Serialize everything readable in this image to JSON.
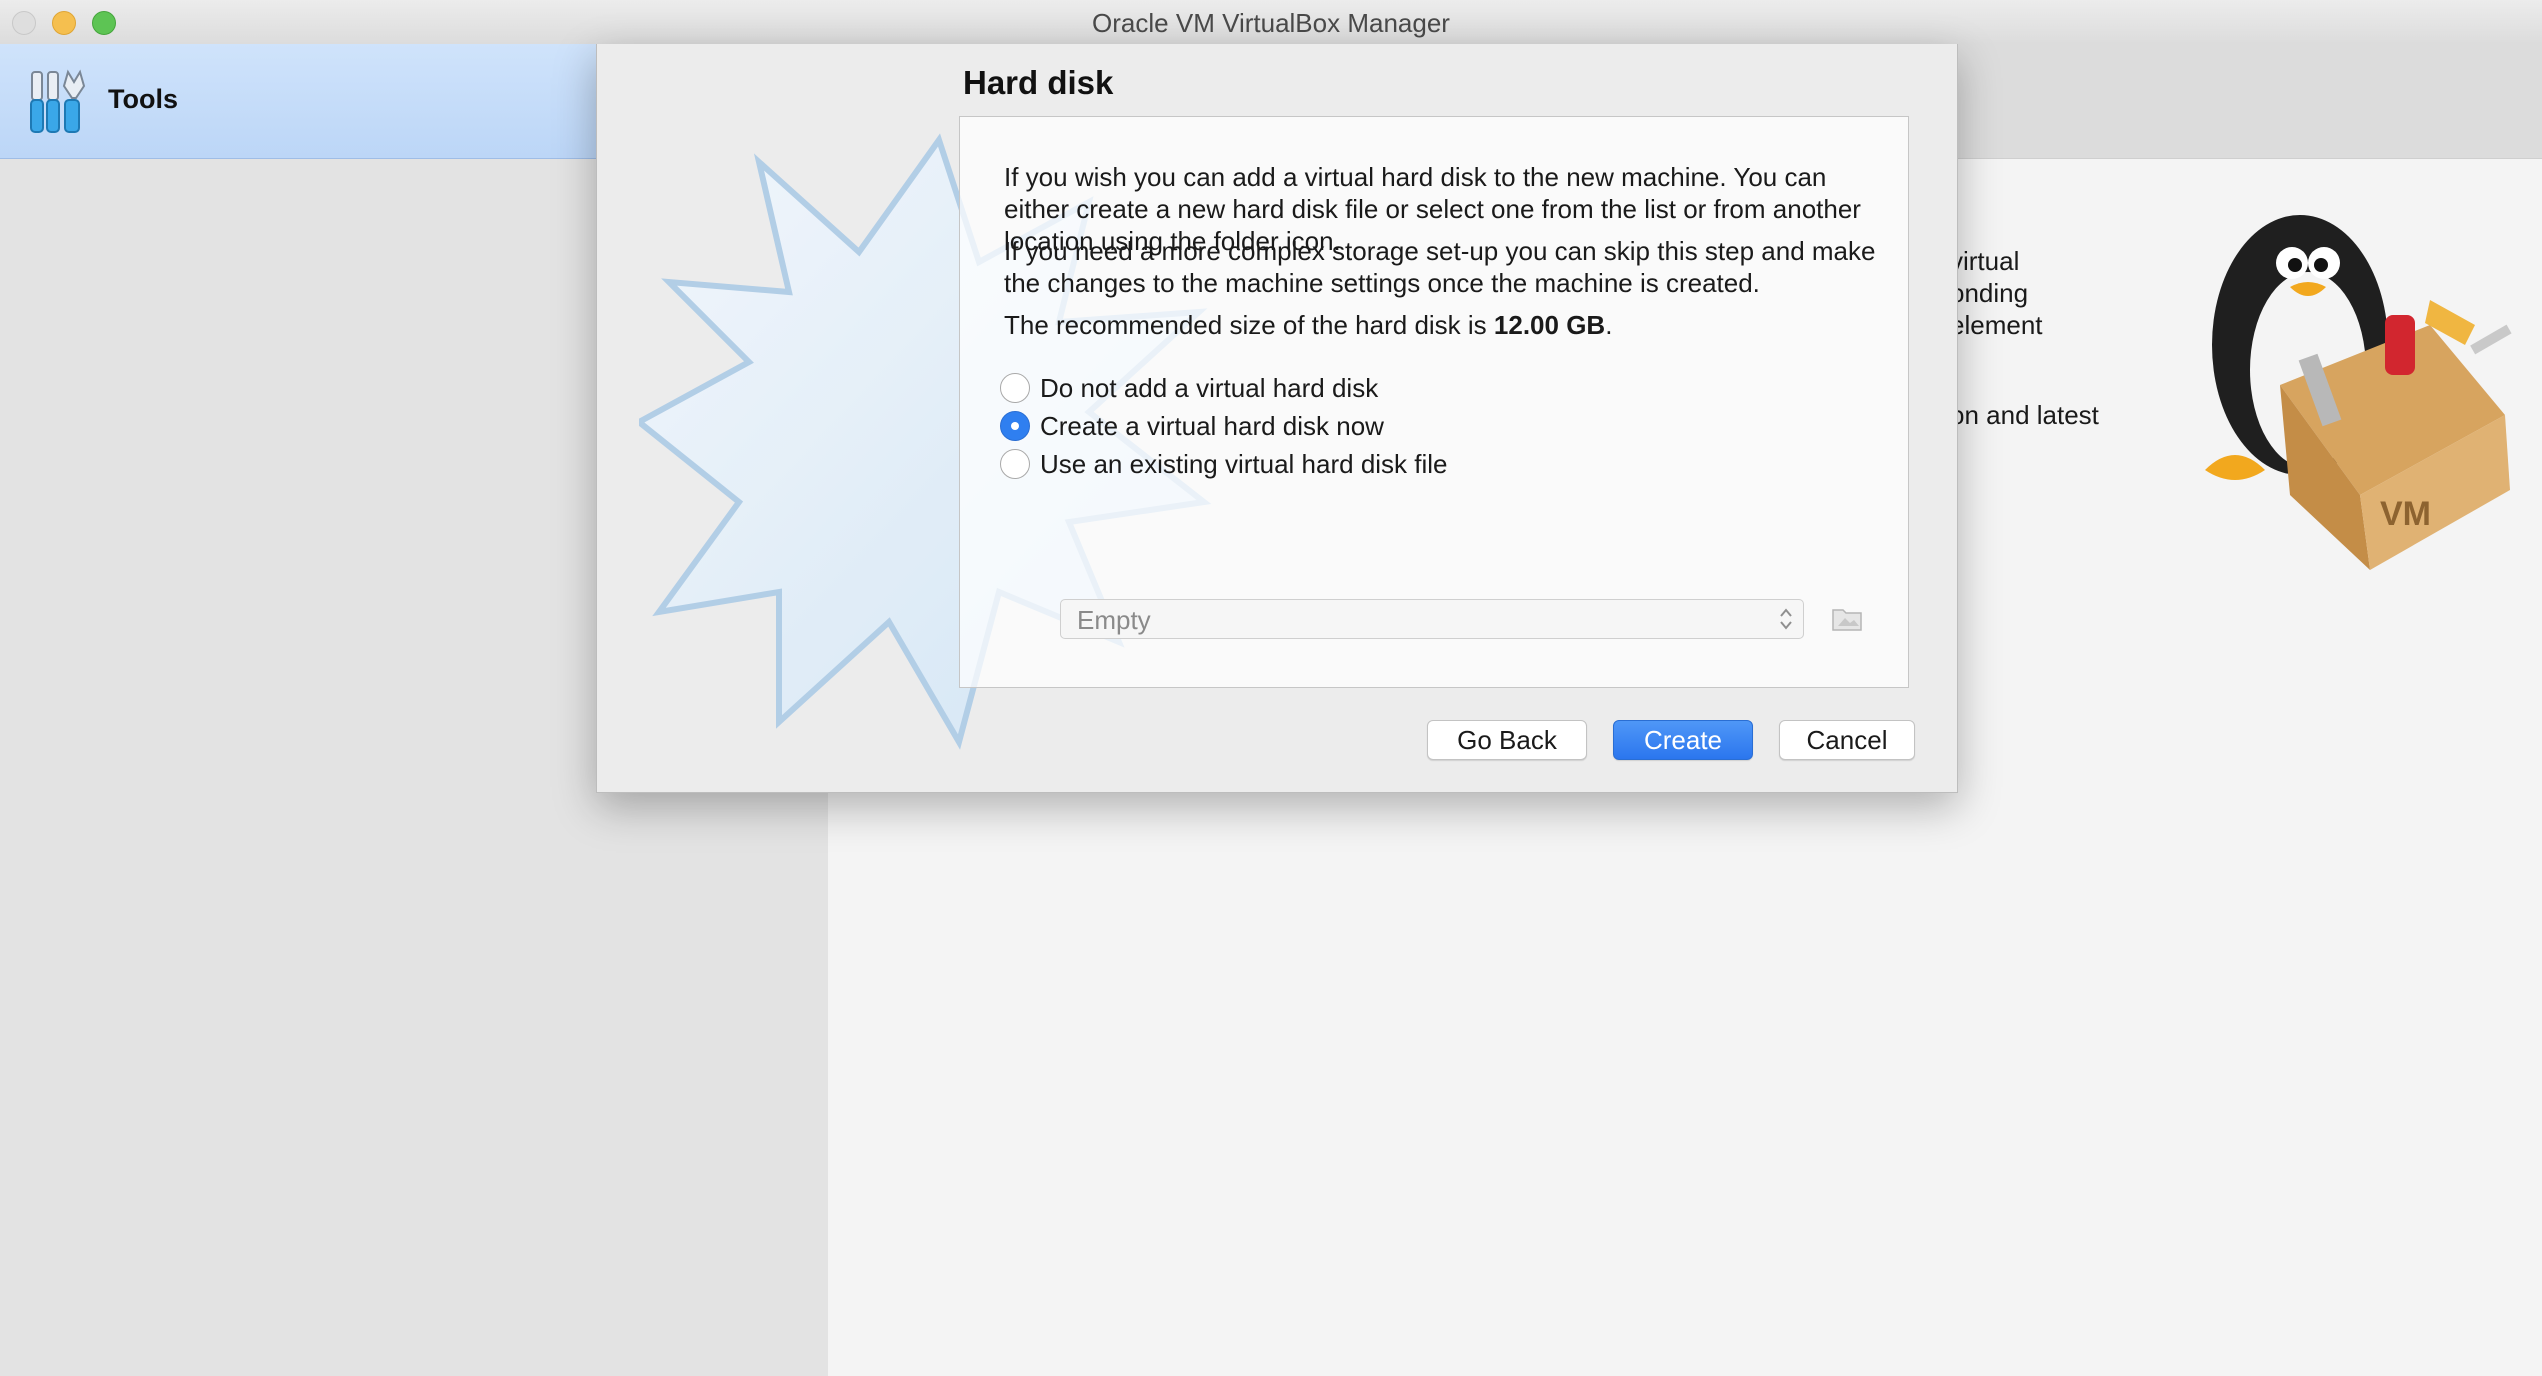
{
  "window": {
    "title": "Oracle VM VirtualBox Manager"
  },
  "sidebar": {
    "tools_label": "Tools"
  },
  "welcome": {
    "lines": [
      "virtual",
      "onding",
      "element",
      "on and latest"
    ]
  },
  "dialog": {
    "title": "Hard disk",
    "paragraph1": "If you wish you can add a virtual hard disk to the new machine. You can either create a new hard disk file or select one from the list or from another location using the folder icon.",
    "paragraph2": "If you need a more complex storage set-up you can skip this step and make the changes to the machine settings once the machine is created.",
    "recommended_prefix": "The recommended size of the hard disk is ",
    "recommended_size": "12.00 GB",
    "recommended_suffix": ".",
    "options": [
      {
        "label": "Do not add a virtual hard disk",
        "selected": false
      },
      {
        "label": "Create a virtual hard disk now",
        "selected": true
      },
      {
        "label": "Use an existing virtual hard disk file",
        "selected": false
      }
    ],
    "disk_select": {
      "value": "Empty",
      "enabled": false
    },
    "buttons": {
      "back": "Go Back",
      "create": "Create",
      "cancel": "Cancel"
    }
  },
  "colors": {
    "accent": "#2f7ff0",
    "sidebar_selected": "#c5dcf8"
  },
  "icons": [
    "tools-icon",
    "folder-icon",
    "up-down-arrows-icon",
    "wizard-starburst-icon",
    "penguin-toolbox-icon"
  ]
}
